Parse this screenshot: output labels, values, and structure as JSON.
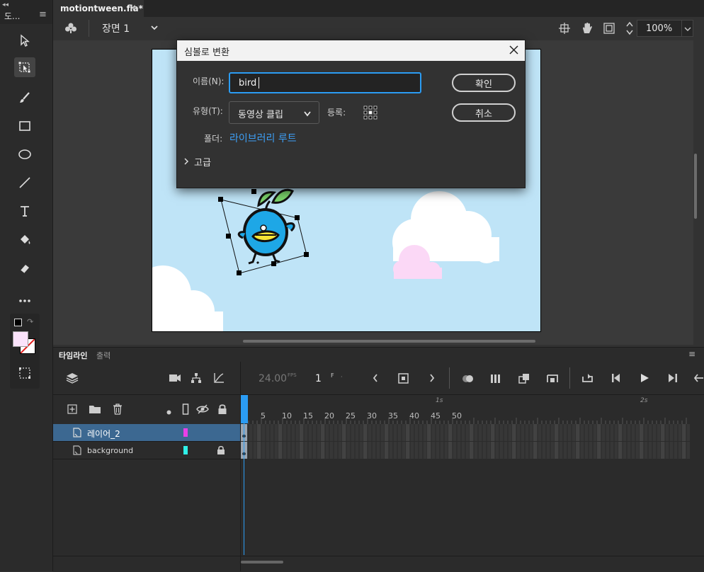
{
  "toolbar": {
    "title": "도...",
    "collapse_glyph": "◂◂",
    "menu_glyph": "≡"
  },
  "document": {
    "tab_title": "motiontween.fla*",
    "close_glyph": "×"
  },
  "editbar": {
    "scene_label": "장면 1",
    "zoom_value": "100%"
  },
  "dialog": {
    "title": "심볼로 변환",
    "name_label": "이름(N):",
    "name_value": "bird",
    "type_label": "유형(T):",
    "type_value": "동영상 클립",
    "registration_label": "등록:",
    "folder_label": "폴더:",
    "folder_value": "라이브러리 루트",
    "advanced_label": "고급",
    "ok_label": "확인",
    "cancel_label": "취소"
  },
  "timeline": {
    "tabs": [
      "타임라인",
      "출력"
    ],
    "fps_value": "24.00",
    "fps_unit": "FPS",
    "frame_value": "1",
    "frame_unit": "F",
    "second_markers": [
      "1s",
      "2s"
    ],
    "frame_ticks": [
      "5",
      "10",
      "15",
      "20",
      "25",
      "30",
      "35",
      "40",
      "45",
      "50"
    ],
    "layers": [
      {
        "name": "레이어_2",
        "color": "#e83fe8",
        "selected": true
      },
      {
        "name": "background",
        "color": "#2ff0e8",
        "locked": true
      }
    ]
  },
  "colors": {
    "stroke": "#1a1a1a",
    "fill": "#fbe3fb",
    "accent": "#2b9cf3",
    "sky": "#bfe4f7"
  }
}
